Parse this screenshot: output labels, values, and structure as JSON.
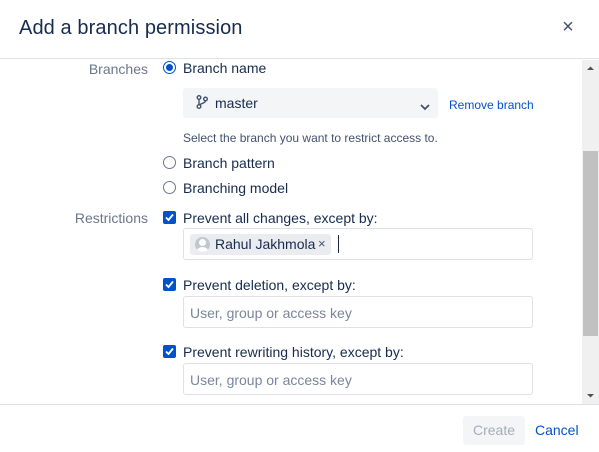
{
  "dialog": {
    "title": "Add a branch permission",
    "close_symbol": "×"
  },
  "branches": {
    "label": "Branches",
    "options": [
      {
        "label": "Branch name",
        "selected": true
      },
      {
        "label": "Branch pattern",
        "selected": false
      },
      {
        "label": "Branching model",
        "selected": false
      }
    ],
    "select_value": "master",
    "select_icon": "branch-icon",
    "remove_link": "Remove branch",
    "help_text": "Select the branch you want to restrict access to."
  },
  "restrictions": {
    "label": "Restrictions",
    "items": [
      {
        "label": "Prevent all changes, except by:",
        "checked": true,
        "users": [
          {
            "name": "Rahul Jakhmola",
            "remove": "×"
          }
        ]
      },
      {
        "label": "Prevent deletion, except by:",
        "checked": true,
        "placeholder": "User, group or access key"
      },
      {
        "label": "Prevent rewriting history, except by:",
        "checked": true,
        "placeholder": "User, group or access key"
      }
    ]
  },
  "footer": {
    "create_label": "Create",
    "cancel_label": "Cancel"
  },
  "colors": {
    "accent": "#0052cc",
    "text": "#172b4d",
    "muted": "#6b778c",
    "border": "#dfe1e6"
  }
}
